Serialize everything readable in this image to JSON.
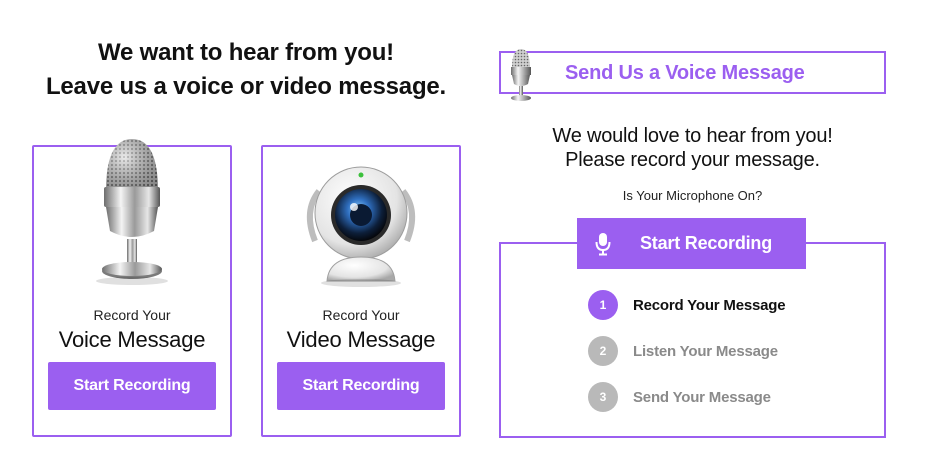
{
  "headline": {
    "line1": "We want to hear from you!",
    "line2": "Leave us a voice or video message."
  },
  "voice_card": {
    "icon": "microphone-icon",
    "small_label": "Record Your",
    "big_label": "Voice Message",
    "button": "Start Recording"
  },
  "video_card": {
    "icon": "webcam-icon",
    "small_label": "Record Your",
    "big_label": "Video Message",
    "button": "Start Recording"
  },
  "voice_panel": {
    "header_icon": "microphone-icon",
    "header_title": "Send Us a Voice Message",
    "intro_line1": "We would love to hear from you!",
    "intro_line2": "Please record your message.",
    "mic_question": "Is Your Microphone On?",
    "record_button": "Start Recording",
    "steps": [
      {
        "number": "1",
        "label": "Record Your Message",
        "state": "active"
      },
      {
        "number": "2",
        "label": "Listen Your Message",
        "state": "inactive"
      },
      {
        "number": "3",
        "label": "Send Your Message",
        "state": "inactive"
      }
    ]
  },
  "colors": {
    "accent": "#9b5ff0",
    "inactive_step": "#b9b9b9",
    "inactive_text": "#8a8a8a"
  }
}
